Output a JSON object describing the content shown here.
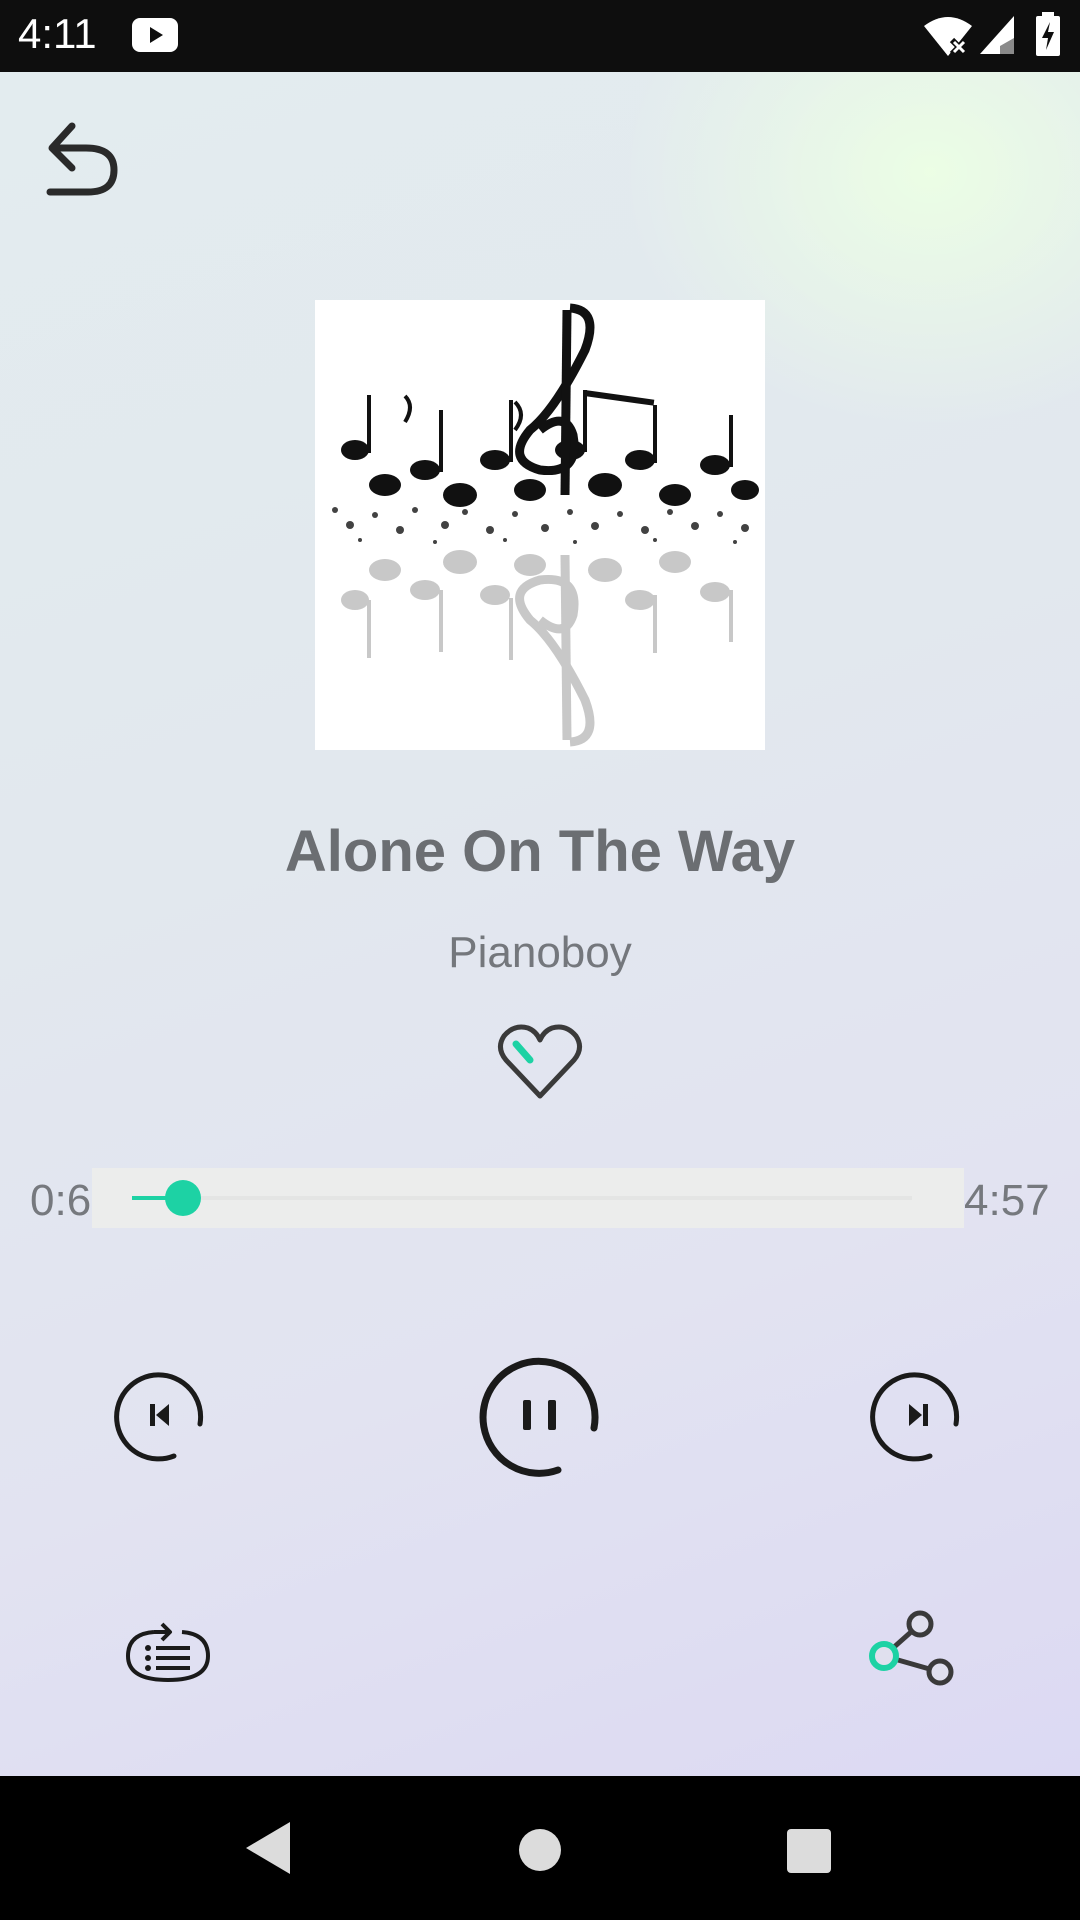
{
  "status_bar": {
    "time": "4:11",
    "icons": [
      "youtube-icon",
      "wifi-off-icon",
      "signal-icon",
      "battery-charging-icon"
    ]
  },
  "player": {
    "back_icon": "undo-arrow-icon",
    "album_art": "music-notes-artwork",
    "title": "Alone On The Way",
    "artist": "Pianoboy",
    "favorite_icon": "heart-outline-icon",
    "time_current": "0:6",
    "time_total": "4:57",
    "progress_fraction": 0.065,
    "controls": [
      "skip-previous-icon",
      "pause-icon",
      "skip-next-icon"
    ],
    "extra_controls": [
      "playlist-icon",
      "share-icon"
    ]
  },
  "colors": {
    "accent": "#1dd2a4",
    "title_text": "#6b6e72",
    "icon_stroke": "#1a1a1a"
  },
  "nav_bar": {
    "buttons": [
      "back-triangle-icon",
      "home-circle-icon",
      "recents-square-icon"
    ]
  }
}
